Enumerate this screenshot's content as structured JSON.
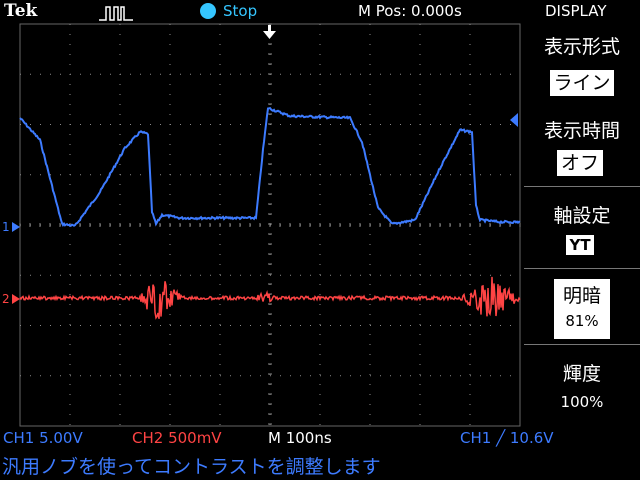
{
  "header": {
    "brand": "Tek",
    "acquisition_icon": "pulse-waveform-icon",
    "run_status": "Stop",
    "horizontal_position": "M Pos: 0.000s",
    "menu_title": "DISPLAY"
  },
  "menu": {
    "display_type": {
      "label": "表示形式",
      "value": "ライン"
    },
    "persistence": {
      "label": "表示時間",
      "value": "オフ"
    },
    "format": {
      "label": "軸設定",
      "value": "YT"
    },
    "contrast": {
      "label": "明暗",
      "value": "81%"
    },
    "brightness": {
      "label": "輝度",
      "value": "100%"
    }
  },
  "status": {
    "ch1_scale": "CH1  5.00V",
    "ch2_scale": "CH2  500mV",
    "timebase": "M 100ns",
    "trigger": "CH1 ╱ 10.6V"
  },
  "help_text": "汎用ノブを使ってコントラストを調整します",
  "markers": {
    "ch1": "1",
    "ch2": "2"
  },
  "colors": {
    "ch1": "#3d7bff",
    "ch2": "#ff4444",
    "run": "#35c6ff",
    "grid": "#8a8a8a"
  }
}
